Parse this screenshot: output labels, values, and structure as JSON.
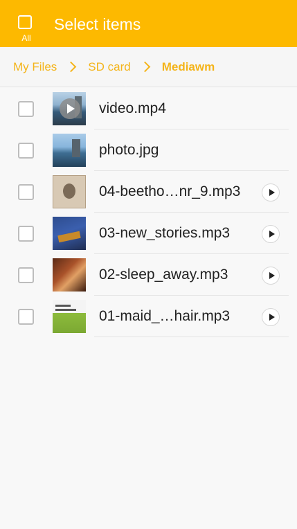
{
  "header": {
    "select_all_label": "All",
    "title": "Select items"
  },
  "breadcrumb": {
    "items": [
      "My Files",
      "SD card",
      "Mediawm"
    ]
  },
  "files": [
    {
      "name": "video.mp4",
      "thumb": "video-thumbnail",
      "has_play": false
    },
    {
      "name": "photo.jpg",
      "thumb": "photo-thumbnail",
      "has_play": false
    },
    {
      "name": "04-beetho…nr_9.mp3",
      "thumb": "album-art-beethoven",
      "has_play": true
    },
    {
      "name": "03-new_stories.mp3",
      "thumb": "album-art-new-stories",
      "has_play": true
    },
    {
      "name": "02-sleep_away.mp3",
      "thumb": "album-art-sleep-away",
      "has_play": true
    },
    {
      "name": "01-maid_…hair.mp3",
      "thumb": "album-art-maid",
      "has_play": true
    }
  ],
  "colors": {
    "accent": "#fdb900",
    "breadcrumb_text": "#f4b41a",
    "background": "#f8f8f8"
  }
}
